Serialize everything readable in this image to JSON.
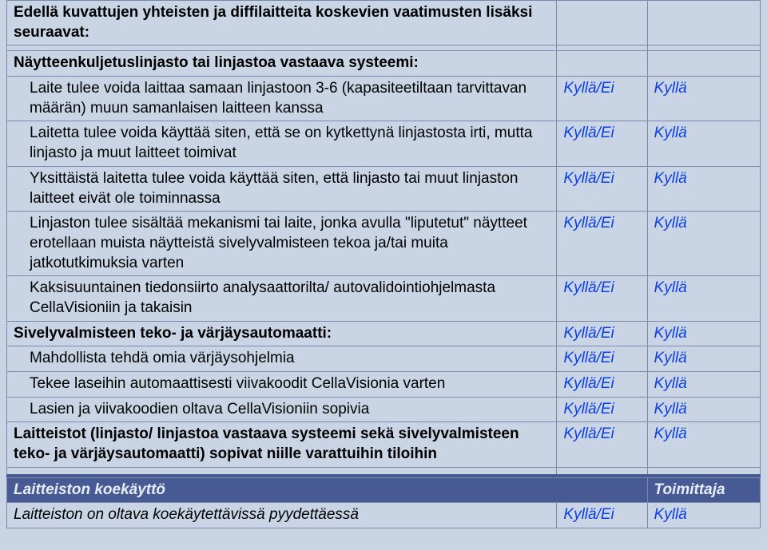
{
  "labels": {
    "yes_no": "Kyllä/Ei",
    "yes": "Kyllä"
  },
  "rows": [
    {
      "text": "Edellä kuvattujen yhteisten ja diffilaitteita koskevien vaatimusten lisäksi seuraavat:",
      "style": "bold",
      "c2": "",
      "c3": ""
    },
    {
      "text": "",
      "style": "",
      "c2": "",
      "c3": ""
    },
    {
      "text": "Näytteenkuljetuslinjasto tai linjastoa vastaava systeemi:",
      "style": "bold",
      "c2": "",
      "c3": ""
    },
    {
      "text": "Laite tulee voida laittaa samaan linjastoon 3-6 (kapasiteetiltaan tarvittavan määrän) muun samanlaisen laitteen kanssa",
      "style": "indent1",
      "c2": "yes_no",
      "c3": "yes"
    },
    {
      "text": "Laitetta tulee voida käyttää siten, että se on kytkettynä linjastosta irti, mutta linjasto ja muut laitteet toimivat",
      "style": "indent1",
      "c2": "yes_no",
      "c3": "yes"
    },
    {
      "text": "Yksittäistä laitetta tulee voida käyttää siten, että linjasto tai muut linjaston laitteet eivät ole toiminnassa",
      "style": "indent1",
      "c2": "yes_no",
      "c3": "yes"
    },
    {
      "text": "Linjaston tulee sisältää mekanismi tai laite, jonka avulla \"liputetut\" näytteet erotellaan muista näytteistä sivelyvalmisteen tekoa ja/tai muita jatkotutkimuksia varten",
      "style": "indent1",
      "c2": "yes_no",
      "c3": "yes"
    },
    {
      "text": "Kaksisuuntainen tiedonsiirto analysaattorilta/ autovalidointiohjelmasta CellaVisioniin ja takaisin",
      "style": "indent1",
      "c2": "yes_no",
      "c3": "yes"
    },
    {
      "text": "Sivelyvalmisteen teko- ja värjäysautomaatti:",
      "style": "bold",
      "c2": "yes_no",
      "c3": "yes"
    },
    {
      "text": "Mahdollista tehdä omia värjäysohjelmia",
      "style": "indent1",
      "c2": "yes_no",
      "c3": "yes"
    },
    {
      "text": "Tekee laseihin automaattisesti viivakoodit CellaVisionia varten",
      "style": "indent1",
      "c2": "yes_no",
      "c3": "yes"
    },
    {
      "text": "Lasien ja viivakoodien oltava CellaVisioniin sopivia",
      "style": "indent1",
      "c2": "yes_no",
      "c3": "yes"
    },
    {
      "text": "Laitteistot (linjasto/ linjastoa vastaava systeemi sekä sivelyvalmisteen teko- ja värjäysautomaatti) sopivat niille varattuihin tiloihin",
      "style": "bold",
      "c2": "yes_no",
      "c3": "yes"
    }
  ],
  "section_header": {
    "left": "Laitteiston koekäyttö",
    "right": "Toimittaja"
  },
  "footer_row": {
    "text": "Laitteiston on oltava koekäytettävissä pyydettäessä",
    "c2": "yes_no",
    "c3": "yes"
  }
}
